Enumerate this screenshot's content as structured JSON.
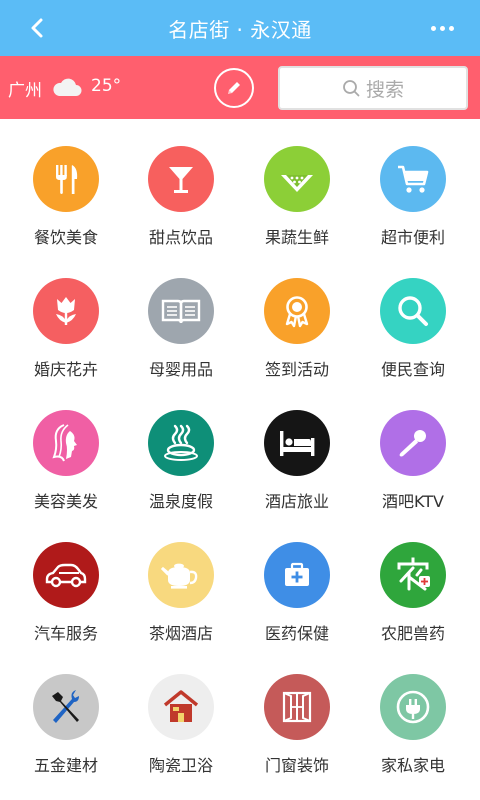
{
  "header": {
    "title": "名店街 · 永汉通",
    "back_icon": "chevron-left-icon",
    "more_icon": "more-dots-icon",
    "bg_color": "#5bbcf6"
  },
  "infobar": {
    "city": "广州",
    "weather_icon": "cloud-icon",
    "temperature": "25°",
    "edit_icon": "pencil-icon",
    "search_placeholder": "搜索",
    "bg_color": "#ff5f6e"
  },
  "categories": [
    {
      "label": "餐饮美食",
      "icon": "fork-knife-icon",
      "color": "#f9a12a"
    },
    {
      "label": "甜点饮品",
      "icon": "cocktail-glass-icon",
      "color": "#f7605e"
    },
    {
      "label": "果蔬生鲜",
      "icon": "watermelon-icon",
      "color": "#8ccf37"
    },
    {
      "label": "超市便利",
      "icon": "shopping-cart-icon",
      "color": "#5cb9f0"
    },
    {
      "label": "婚庆花卉",
      "icon": "tulip-icon",
      "color": "#f55f61"
    },
    {
      "label": "母婴用品",
      "icon": "open-book-icon",
      "color": "#9ea6ae"
    },
    {
      "label": "签到活动",
      "icon": "medal-icon",
      "color": "#f9a12a"
    },
    {
      "label": "便民查询",
      "icon": "magnifier-icon",
      "color": "#35d3c2"
    },
    {
      "label": "美容美发",
      "icon": "woman-profile-icon",
      "color": "#f05fa4"
    },
    {
      "label": "温泉度假",
      "icon": "hot-spring-icon",
      "color": "#0e8f78"
    },
    {
      "label": "酒店旅业",
      "icon": "bed-icon",
      "color": "#151515"
    },
    {
      "label": "酒吧KTV",
      "icon": "microphone-icon",
      "color": "#b06fe7"
    },
    {
      "label": "汽车服务",
      "icon": "car-icon",
      "color": "#b01a1a"
    },
    {
      "label": "茶烟酒店",
      "icon": "teapot-icon",
      "color": "#f8d97f"
    },
    {
      "label": "医药保健",
      "icon": "medical-kit-icon",
      "color": "#3f8ee6"
    },
    {
      "label": "农肥兽药",
      "icon": "nong-character-icon",
      "color": "#2fa63c"
    },
    {
      "label": "五金建材",
      "icon": "tools-icon",
      "color": "#c8c8c8"
    },
    {
      "label": "陶瓷卫浴",
      "icon": "house-icon",
      "color": "#eeeeee"
    },
    {
      "label": "门窗装饰",
      "icon": "window-icon",
      "color": "#c55a59"
    },
    {
      "label": "家私家电",
      "icon": "power-plug-icon",
      "color": "#7ec7a4"
    }
  ]
}
